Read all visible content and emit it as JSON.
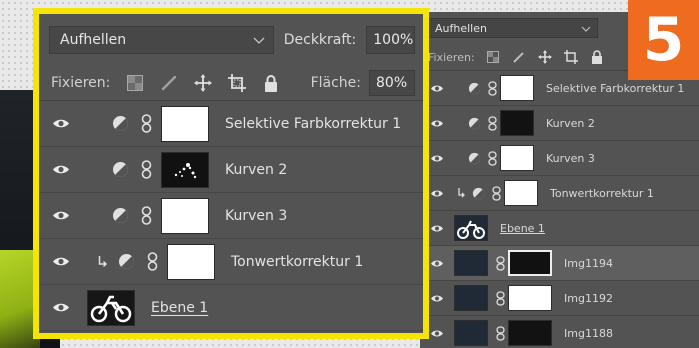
{
  "badge": {
    "number": "5",
    "color": "#ee6b1f"
  },
  "front_panel": {
    "highlight_color": "#f6e500",
    "blend_mode": "Aufhellen",
    "opacity_label": "Deckkraft:",
    "opacity_value": "100%",
    "lock_label": "Fixieren:",
    "fill_label": "Fläche:",
    "fill_value": "80%",
    "layers": [
      {
        "name": "Selektive Farbkorrektur 1",
        "thumb": "white"
      },
      {
        "name": "Kurven 2",
        "thumb": "dark"
      },
      {
        "name": "Kurven 3",
        "thumb": "white"
      },
      {
        "name": "Tonwertkorrektur 1",
        "thumb": "white",
        "clipped": true
      },
      {
        "name": "Ebene 1",
        "thumb": "photo"
      }
    ]
  },
  "back_panel": {
    "blend_mode": "Aufhellen",
    "lock_label": "Fixieren:",
    "layers": [
      {
        "name": "Selektive Farbkorrektur 1"
      },
      {
        "name": "Kurven 2"
      },
      {
        "name": "Kurven 3"
      },
      {
        "name": "Tonwertkorrektur 1"
      },
      {
        "name": "Ebene 1"
      },
      {
        "name": "Img1194"
      },
      {
        "name": "Img1192"
      },
      {
        "name": "Img1188"
      }
    ]
  }
}
